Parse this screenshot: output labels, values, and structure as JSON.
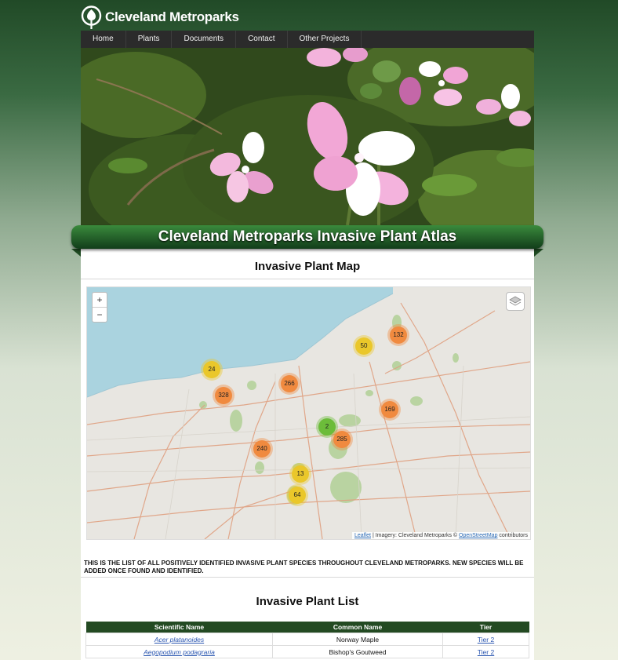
{
  "brand": {
    "name": "Cleveland Metroparks"
  },
  "nav": {
    "items": [
      "Home",
      "Plants",
      "Documents",
      "Contact",
      "Other Projects"
    ]
  },
  "page": {
    "title": "Cleveland Metroparks Invasive Plant Atlas"
  },
  "map_section": {
    "title": "Invasive Plant Map",
    "zoom_in": "+",
    "zoom_out": "−",
    "clusters": [
      {
        "count": "132",
        "color": "orange"
      },
      {
        "count": "50",
        "color": "yellow"
      },
      {
        "count": "24",
        "color": "yellow"
      },
      {
        "count": "266",
        "color": "orange"
      },
      {
        "count": "328",
        "color": "orange"
      },
      {
        "count": "169",
        "color": "orange"
      },
      {
        "count": "2",
        "color": "green"
      },
      {
        "count": "285",
        "color": "orange"
      },
      {
        "count": "240",
        "color": "orange"
      },
      {
        "count": "13",
        "color": "yellow"
      },
      {
        "count": "64",
        "color": "yellow"
      }
    ],
    "attribution": {
      "leaflet": "Leaflet",
      "imagery": "| Imagery: Cleveland Metroparks ©",
      "osm": "OpenStreetMap",
      "contributors": "contributors"
    }
  },
  "intro_text": "This is the list of all positively identified invasive plant species throughout Cleveland Metroparks. New species will be added once found and identified.",
  "list_section": {
    "title": "Invasive Plant List",
    "columns": [
      "Scientific Name",
      "Common Name",
      "Tier"
    ],
    "rows": [
      {
        "scientific": "Acer platanoides",
        "common": "Norway Maple",
        "tier": "Tier 2"
      },
      {
        "scientific": "Aegopodium podagraria",
        "common": "Bishop's Goutweed",
        "tier": "Tier 2"
      }
    ]
  },
  "colors": {
    "header_green": "#214a27",
    "table_header": "#234a22",
    "nav_bg": "#2b2b2b",
    "lake": "#aad3df",
    "cluster_orange": "#f08a3f",
    "cluster_yellow": "#eac72a",
    "cluster_green": "#6cbc3a",
    "link_blue": "#2a56b0"
  }
}
